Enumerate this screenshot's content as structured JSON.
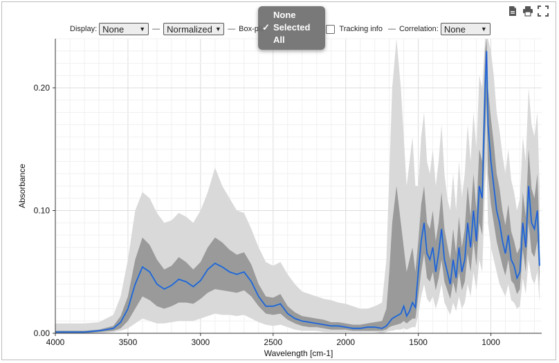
{
  "toolbar": {
    "icons": [
      "export-document-icon",
      "print-icon",
      "fullscreen-icon"
    ]
  },
  "controls": {
    "display_label": "Display:",
    "display_value": "None",
    "normalization_value": "Normalized",
    "separator": "—",
    "boxplot_label": "Box-plo",
    "tracking_label": "Tracking info",
    "correlation_label": "Correlation:",
    "correlation_value": "None"
  },
  "dropdown": {
    "items": [
      "None",
      "Selected",
      "All"
    ],
    "selected_index": 1,
    "check_mark": "✓"
  },
  "chart_data": {
    "type": "line",
    "xlabel": "Wavelength [cm-1]",
    "ylabel": "Absorbance",
    "xlim": [
      4000,
      650
    ],
    "ylim": [
      0,
      0.24
    ],
    "x_reversed": true,
    "x_ticks": [
      4000,
      3500,
      3000,
      2500,
      2000,
      1500,
      1000
    ],
    "x_tick_labels": [
      "4000",
      "3500",
      "3000",
      "2500",
      "2000",
      "1500",
      "1000"
    ],
    "y_ticks": [
      0,
      0.1,
      0.2
    ],
    "y_tick_labels": [
      "0.00",
      "0.10",
      "0.20"
    ],
    "grid": true,
    "colors": {
      "outer_band": "#d9d9d9",
      "inner_band": "#9a9a9a",
      "mean_line": "#2a4ed6",
      "selected_line": "#1f9ad6",
      "highlight_line": "#5fd0a8"
    },
    "x": [
      4000,
      3900,
      3800,
      3700,
      3600,
      3550,
      3500,
      3450,
      3400,
      3350,
      3300,
      3250,
      3200,
      3150,
      3100,
      3050,
      3000,
      2950,
      2900,
      2850,
      2800,
      2750,
      2700,
      2650,
      2600,
      2550,
      2500,
      2450,
      2400,
      2350,
      2300,
      2250,
      2200,
      2150,
      2100,
      2050,
      2000,
      1950,
      1900,
      1850,
      1800,
      1750,
      1720,
      1700,
      1680,
      1650,
      1620,
      1600,
      1580,
      1560,
      1540,
      1520,
      1500,
      1480,
      1460,
      1440,
      1420,
      1400,
      1380,
      1360,
      1340,
      1320,
      1300,
      1280,
      1260,
      1240,
      1220,
      1200,
      1180,
      1160,
      1140,
      1120,
      1100,
      1080,
      1060,
      1040,
      1030,
      1020,
      1000,
      980,
      960,
      940,
      920,
      900,
      880,
      860,
      840,
      820,
      800,
      780,
      760,
      740,
      720,
      700,
      680,
      665
    ],
    "series": [
      {
        "values": [
          0.001,
          0.001,
          0.001,
          0.002,
          0.004,
          0.009,
          0.02,
          0.04,
          0.054,
          0.05,
          0.04,
          0.036,
          0.039,
          0.044,
          0.042,
          0.038,
          0.043,
          0.052,
          0.057,
          0.054,
          0.05,
          0.048,
          0.05,
          0.042,
          0.03,
          0.022,
          0.022,
          0.024,
          0.016,
          0.012,
          0.01,
          0.009,
          0.008,
          0.007,
          0.006,
          0.006,
          0.005,
          0.004,
          0.004,
          0.005,
          0.005,
          0.004,
          0.006,
          0.009,
          0.012,
          0.014,
          0.016,
          0.022,
          0.014,
          0.018,
          0.025,
          0.021,
          0.05,
          0.075,
          0.09,
          0.065,
          0.06,
          0.07,
          0.05,
          0.065,
          0.085,
          0.06,
          0.05,
          0.04,
          0.06,
          0.045,
          0.07,
          0.05,
          0.06,
          0.09,
          0.07,
          0.1,
          0.075,
          0.12,
          0.11,
          0.2,
          0.23,
          0.17,
          0.14,
          0.12,
          0.1,
          0.09,
          0.075,
          0.065,
          0.08,
          0.06,
          0.055,
          0.045,
          0.05,
          0.09,
          0.07,
          0.12,
          0.09,
          0.085,
          0.1,
          0.055
        ],
        "lower_inner": [
          0.0,
          0.0,
          0.0,
          0.001,
          0.002,
          0.004,
          0.01,
          0.02,
          0.03,
          0.027,
          0.022,
          0.02,
          0.022,
          0.025,
          0.025,
          0.024,
          0.028,
          0.033,
          0.036,
          0.035,
          0.034,
          0.033,
          0.035,
          0.03,
          0.022,
          0.016,
          0.015,
          0.016,
          0.011,
          0.008,
          0.006,
          0.005,
          0.005,
          0.004,
          0.003,
          0.003,
          0.003,
          0.002,
          0.002,
          0.002,
          0.002,
          0.002,
          0.003,
          0.005,
          0.006,
          0.007,
          0.008,
          0.01,
          0.008,
          0.01,
          0.012,
          0.012,
          0.03,
          0.05,
          0.065,
          0.045,
          0.042,
          0.05,
          0.035,
          0.045,
          0.06,
          0.042,
          0.035,
          0.028,
          0.042,
          0.032,
          0.05,
          0.035,
          0.042,
          0.065,
          0.05,
          0.075,
          0.055,
          0.09,
          0.08,
          0.16,
          0.19,
          0.13,
          0.105,
          0.09,
          0.075,
          0.065,
          0.055,
          0.047,
          0.06,
          0.043,
          0.04,
          0.032,
          0.036,
          0.068,
          0.05,
          0.09,
          0.066,
          0.062,
          0.075,
          0.04
        ],
        "upper_inner": [
          0.002,
          0.002,
          0.002,
          0.003,
          0.006,
          0.014,
          0.03,
          0.06,
          0.078,
          0.072,
          0.06,
          0.052,
          0.055,
          0.062,
          0.058,
          0.052,
          0.058,
          0.07,
          0.078,
          0.074,
          0.068,
          0.064,
          0.066,
          0.056,
          0.04,
          0.03,
          0.029,
          0.032,
          0.022,
          0.017,
          0.014,
          0.013,
          0.012,
          0.011,
          0.009,
          0.009,
          0.008,
          0.007,
          0.007,
          0.008,
          0.009,
          0.01,
          0.02,
          0.05,
          0.09,
          0.12,
          0.09,
          0.07,
          0.05,
          0.06,
          0.07,
          0.05,
          0.075,
          0.105,
          0.12,
          0.09,
          0.085,
          0.1,
          0.075,
          0.09,
          0.115,
          0.085,
          0.072,
          0.06,
          0.085,
          0.065,
          0.095,
          0.07,
          0.085,
          0.12,
          0.095,
          0.13,
          0.1,
          0.15,
          0.14,
          0.23,
          0.24,
          0.2,
          0.175,
          0.155,
          0.13,
          0.118,
          0.1,
          0.088,
          0.105,
          0.083,
          0.075,
          0.065,
          0.07,
          0.115,
          0.095,
          0.15,
          0.118,
          0.11,
          0.13,
          0.078
        ],
        "lower_outer": [
          0.0,
          0.0,
          0.0,
          0.0,
          0.001,
          0.002,
          0.004,
          0.008,
          0.012,
          0.01,
          0.008,
          0.008,
          0.009,
          0.01,
          0.01,
          0.01,
          0.012,
          0.014,
          0.016,
          0.015,
          0.015,
          0.014,
          0.015,
          0.012,
          0.009,
          0.007,
          0.006,
          0.007,
          0.005,
          0.003,
          0.002,
          0.002,
          0.002,
          0.001,
          0.001,
          0.001,
          0.001,
          0.001,
          0.001,
          0.001,
          0.001,
          0.0,
          0.001,
          0.002,
          0.002,
          0.003,
          0.003,
          0.004,
          0.003,
          0.004,
          0.005,
          0.005,
          0.015,
          0.03,
          0.04,
          0.028,
          0.025,
          0.03,
          0.02,
          0.028,
          0.04,
          0.025,
          0.02,
          0.015,
          0.025,
          0.018,
          0.03,
          0.02,
          0.025,
          0.04,
          0.03,
          0.05,
          0.035,
          0.06,
          0.05,
          0.12,
          0.14,
          0.09,
          0.07,
          0.06,
          0.05,
          0.04,
          0.035,
          0.03,
          0.04,
          0.027,
          0.025,
          0.02,
          0.022,
          0.045,
          0.032,
          0.06,
          0.045,
          0.04,
          0.05,
          0.025
        ],
        "upper_outer": [
          0.008,
          0.008,
          0.008,
          0.009,
          0.015,
          0.03,
          0.06,
          0.1,
          0.115,
          0.11,
          0.098,
          0.09,
          0.092,
          0.098,
          0.095,
          0.09,
          0.1,
          0.115,
          0.135,
          0.12,
          0.11,
          0.1,
          0.098,
          0.085,
          0.07,
          0.058,
          0.055,
          0.058,
          0.048,
          0.04,
          0.034,
          0.032,
          0.03,
          0.028,
          0.027,
          0.025,
          0.024,
          0.022,
          0.02,
          0.02,
          0.022,
          0.025,
          0.06,
          0.13,
          0.2,
          0.24,
          0.2,
          0.16,
          0.12,
          0.14,
          0.16,
          0.12,
          0.12,
          0.16,
          0.18,
          0.14,
          0.13,
          0.15,
          0.12,
          0.14,
          0.17,
          0.13,
          0.11,
          0.1,
          0.13,
          0.1,
          0.14,
          0.11,
          0.13,
          0.17,
          0.14,
          0.18,
          0.15,
          0.21,
          0.2,
          0.24,
          0.24,
          0.24,
          0.23,
          0.21,
          0.18,
          0.165,
          0.145,
          0.13,
          0.15,
          0.125,
          0.115,
          0.1,
          0.11,
          0.16,
          0.14,
          0.2,
          0.17,
          0.16,
          0.18,
          0.12
        ]
      }
    ]
  }
}
